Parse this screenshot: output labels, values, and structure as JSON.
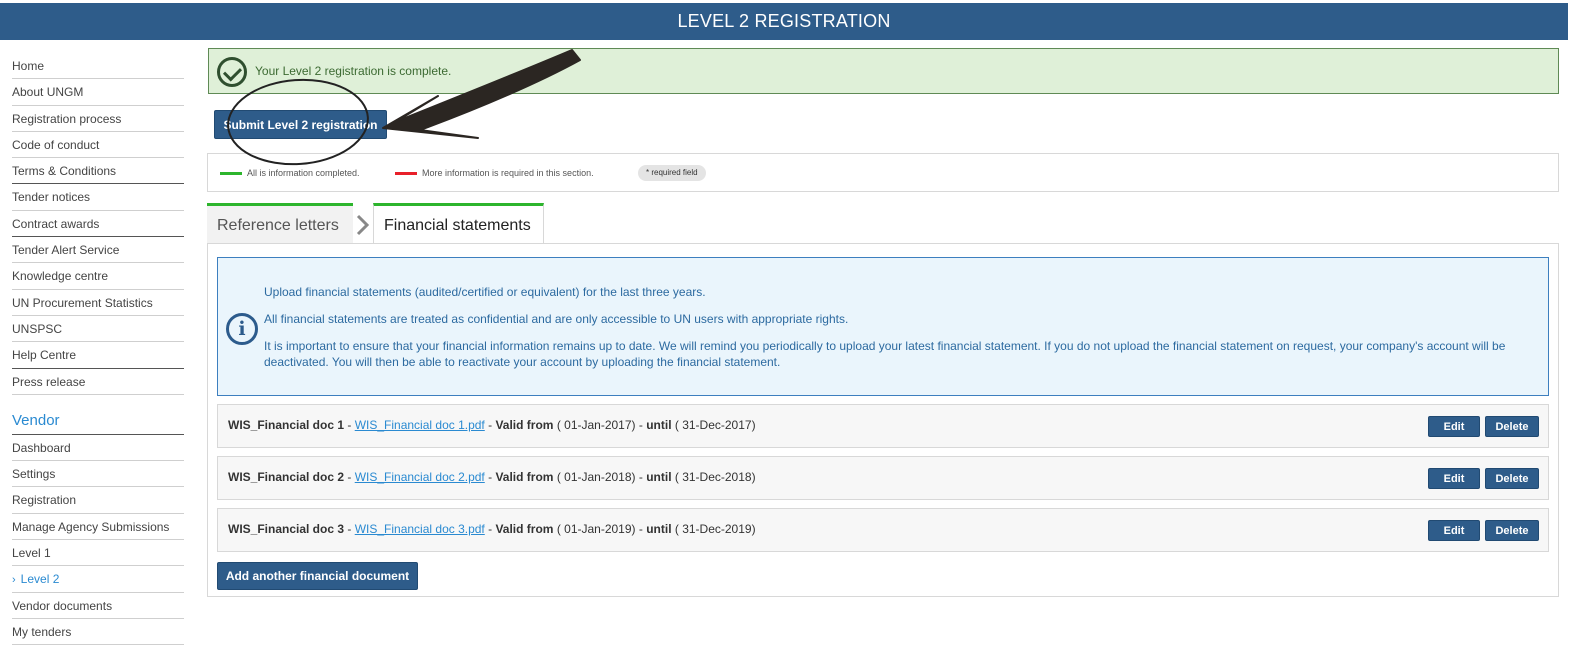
{
  "header": {
    "title": "LEVEL 2 REGISTRATION"
  },
  "sidebar": {
    "items": [
      {
        "label": "Home"
      },
      {
        "label": "About UNGM"
      },
      {
        "label": "Registration process"
      },
      {
        "label": "Code of conduct"
      },
      {
        "label": "Terms & Conditions"
      },
      {
        "label": "Tender notices"
      },
      {
        "label": "Contract awards"
      },
      {
        "label": "Tender Alert Service"
      },
      {
        "label": "Knowledge centre"
      },
      {
        "label": "UN Procurement Statistics"
      },
      {
        "label": "UNSPSC"
      },
      {
        "label": "Help Centre"
      },
      {
        "label": "Press release"
      }
    ],
    "vendor_header": "Vendor",
    "vendor_items": [
      {
        "label": "Dashboard"
      },
      {
        "label": "Settings"
      },
      {
        "label": "Registration"
      },
      {
        "label": "Manage Agency Submissions"
      },
      {
        "label": "Level 1"
      },
      {
        "label": "Level 2",
        "active": true
      },
      {
        "label": "Vendor documents"
      },
      {
        "label": "My tenders"
      }
    ],
    "active_chevron": "›"
  },
  "alert": {
    "message": "Your Level 2 registration is complete.",
    "icon": "check-circle-icon",
    "color": "#dff0d8"
  },
  "submit_button": "Submit Level 2 registration",
  "legend": {
    "complete_text": "All is information completed.",
    "complete_color": "#2db52d",
    "incomplete_text": "More information is required in this section.",
    "incomplete_color": "#e8202a",
    "required_badge": "* required field"
  },
  "tabs": [
    {
      "label": "Reference letters"
    },
    {
      "label": "Financial statements",
      "active": true
    }
  ],
  "info": {
    "icon": "info-icon",
    "icon_glyph": "i",
    "line1": "Upload financial statements (audited/certified or equivalent) for the last three years.",
    "line2": "All financial statements are treated as confidential and are only accessible to UN users with appropriate rights.",
    "line3": "It is important to ensure that your financial information remains up to date. We will remind you periodically to upload your latest financial statement. If you do not upload the financial statement on request, your company's account will be deactivated. You will then be able to reactivate your account by uploading the financial statement."
  },
  "doc_labels": {
    "sep": " - ",
    "valid_from": "Valid from",
    "until": "until",
    "edit": "Edit",
    "delete": "Delete"
  },
  "documents": [
    {
      "name": "WIS_Financial doc 1",
      "file": "WIS_Financial doc 1.pdf",
      "from": "( 01-Jan-2017)",
      "to": "( 31-Dec-2017)"
    },
    {
      "name": "WIS_Financial doc 2",
      "file": "WIS_Financial doc 2.pdf",
      "from": "( 01-Jan-2018)",
      "to": "( 31-Dec-2018)"
    },
    {
      "name": "WIS_Financial doc 3",
      "file": "WIS_Financial doc 3.pdf",
      "from": "( 01-Jan-2019)",
      "to": "( 31-Dec-2019)"
    }
  ],
  "add_button": "Add another financial document",
  "colors": {
    "brand": "#2e5c8a",
    "link": "#2a8ad1",
    "tab_accent": "#2db52d"
  }
}
